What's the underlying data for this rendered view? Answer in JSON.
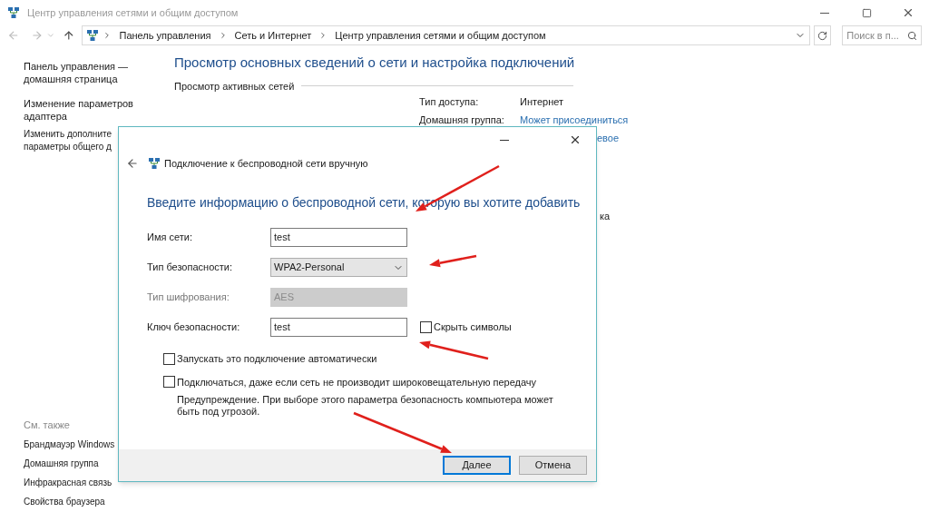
{
  "window": {
    "title": "Центр управления сетями и общим доступом"
  },
  "address_bar": {
    "breadcrumbs": [
      "Панель управления",
      "Сеть и Интернет",
      "Центр управления сетями и общим доступом"
    ],
    "search": {
      "placeholder": "Поиск в п..."
    }
  },
  "sidebar": {
    "links": [
      "Панель управления — домашняя страница",
      "Изменение параметров адаптера",
      "Изменить дополните",
      "параметры общего д"
    ],
    "see_also": {
      "heading": "См. также",
      "links": [
        "Брандмауэр Windows",
        "Домашняя группа",
        "Инфракрасная связь",
        "Свойства браузера"
      ]
    }
  },
  "main": {
    "heading": "Просмотр основных сведений о сети и настройка подключений",
    "section": "Просмотр активных сетей",
    "info": [
      {
        "label": "Тип доступа:",
        "value": "Интернет",
        "link": false
      },
      {
        "label": "Домашняя группа:",
        "value": "Может присоединиться",
        "link": true
      }
    ],
    "partial_texts": [
      "евое",
      "ка"
    ]
  },
  "dialog": {
    "title": "Подключение к беспроводной сети вручную",
    "heading": "Введите информацию о беспроводной сети, которую вы хотите добавить",
    "fields": [
      {
        "kind": "text",
        "label": "Имя сети:",
        "value": "test",
        "disabled": false
      },
      {
        "kind": "select",
        "label": "Тип безопасности:",
        "value": "WPA2-Personal",
        "disabled": false
      },
      {
        "kind": "select",
        "label": "Тип шифрования:",
        "value": "AES",
        "disabled": true
      },
      {
        "kind": "text",
        "label": "Ключ безопасности:",
        "value": "test",
        "disabled": false,
        "option": {
          "label": "Скрыть символы",
          "checked": false
        }
      }
    ],
    "checkboxes": [
      {
        "label": "Запускать это подключение автоматически",
        "checked": false
      },
      {
        "label": "Подключаться, даже если сеть не производит широковещательную передачу",
        "checked": false,
        "note": "Предупреждение. При выборе этого параметра безопасность компьютера может быть под угрозой."
      }
    ],
    "buttons": [
      {
        "label": "Далее",
        "default": true
      },
      {
        "label": "Отмена",
        "default": false
      }
    ]
  }
}
